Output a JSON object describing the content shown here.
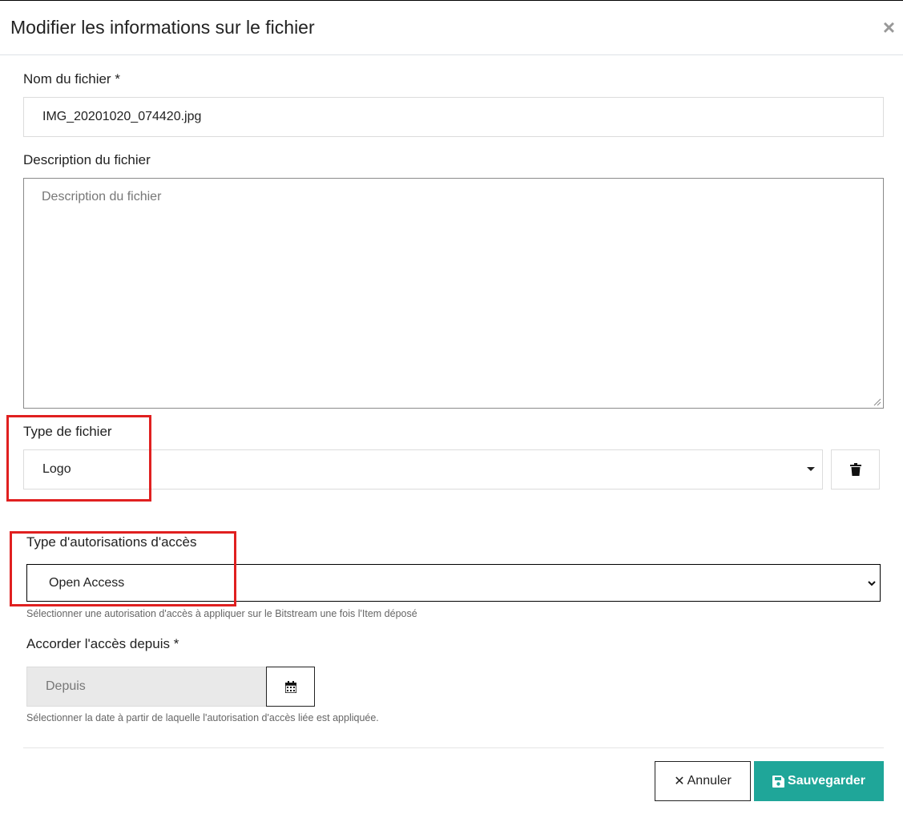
{
  "dialog": {
    "title": "Modifier les informations sur le fichier",
    "close_symbol": "×"
  },
  "file_name": {
    "label": "Nom du fichier *",
    "value": "IMG_20201020_074420.jpg"
  },
  "file_description": {
    "label": "Description du fichier",
    "placeholder": "Description du fichier",
    "value": ""
  },
  "file_type": {
    "label": "Type de fichier",
    "value": "Logo",
    "delete_icon": "trash-icon"
  },
  "access_type": {
    "label": "Type d'autorisations d'accès",
    "selected": "Open Access",
    "help": "Sélectionner une autorisation d'accès à appliquer sur le Bitstream une fois l'Item déposé"
  },
  "grant_access": {
    "label": "Accorder l'accès depuis *",
    "placeholder": "Depuis",
    "calendar_icon": "calendar-icon",
    "help": "Sélectionner la date à partir de laquelle l'autorisation d'accès liée est appliquée."
  },
  "footer": {
    "cancel_icon": "✕",
    "cancel_label": "Annuler",
    "save_icon": "save-icon",
    "save_label": "Sauvegarder"
  },
  "colors": {
    "save_button": "#1fa699",
    "annotation_box": "#e02020"
  }
}
